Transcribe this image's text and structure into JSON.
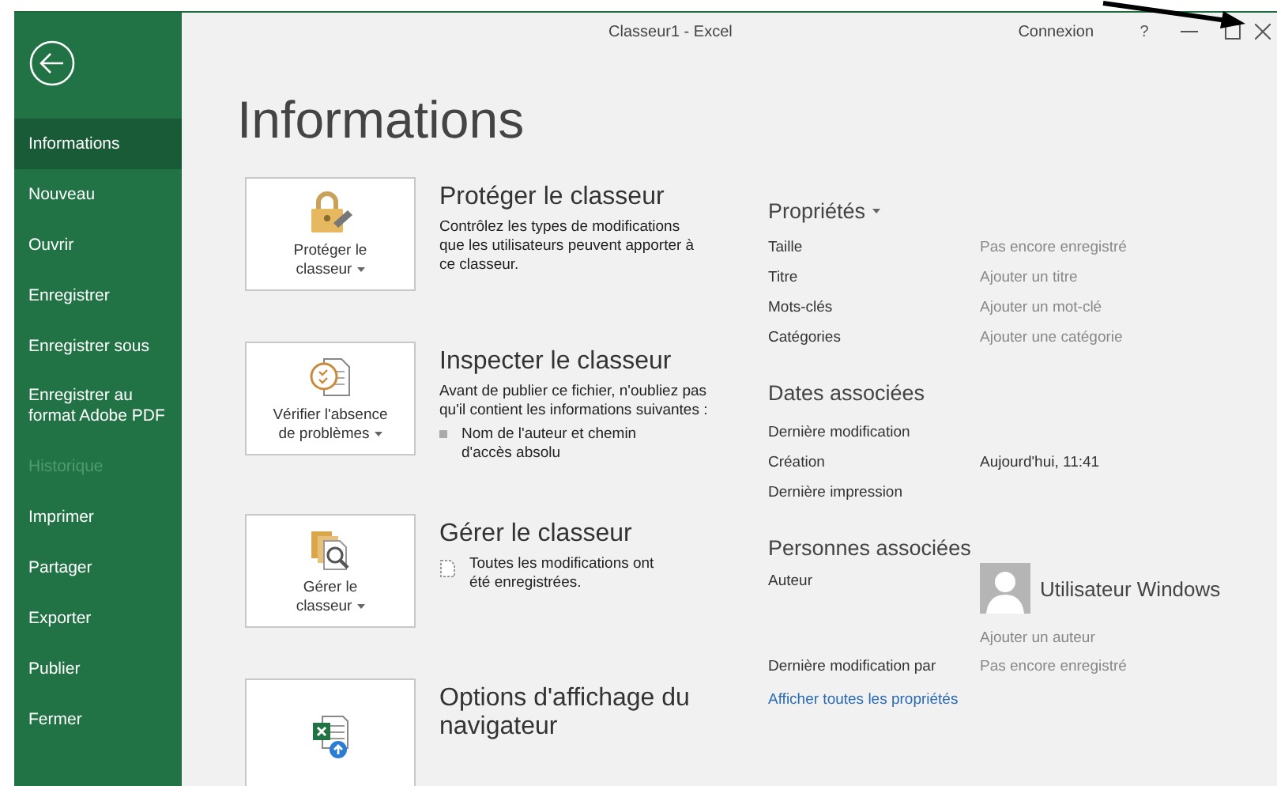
{
  "window": {
    "title": "Classeur1 - Excel",
    "account": "Connexion",
    "help": "?"
  },
  "sidebar": {
    "items": [
      {
        "label": "Informations",
        "selected": true,
        "disabled": false
      },
      {
        "label": "Nouveau",
        "selected": false,
        "disabled": false
      },
      {
        "label": "Ouvrir",
        "selected": false,
        "disabled": false
      },
      {
        "label": "Enregistrer",
        "selected": false,
        "disabled": false
      },
      {
        "label": "Enregistrer sous",
        "selected": false,
        "disabled": false
      },
      {
        "label": "Enregistrer au format Adobe PDF",
        "selected": false,
        "disabled": false
      },
      {
        "label": "Historique",
        "selected": false,
        "disabled": true
      },
      {
        "label": "Imprimer",
        "selected": false,
        "disabled": false
      },
      {
        "label": "Partager",
        "selected": false,
        "disabled": false
      },
      {
        "label": "Exporter",
        "selected": false,
        "disabled": false
      },
      {
        "label": "Publier",
        "selected": false,
        "disabled": false
      },
      {
        "label": "Fermer",
        "selected": false,
        "disabled": false
      }
    ]
  },
  "page": {
    "title": "Informations"
  },
  "actions": [
    {
      "kind": "protect",
      "button_label": "Protéger le\nclasseur",
      "title": "Protéger le classeur",
      "description": "Contrôlez les types de modifications que les utilisateurs peuvent apporter à ce classeur."
    },
    {
      "kind": "inspect",
      "button_label": "Vérifier l'absence\nde problèmes",
      "title": "Inspecter le classeur",
      "description": "Avant de publier ce fichier, n'oubliez pas qu'il contient les informations suivantes :",
      "bullets": [
        "Nom de l'auteur et chemin d'accès absolu"
      ]
    },
    {
      "kind": "manage",
      "button_label": "Gérer le\nclasseur",
      "title": "Gérer le classeur",
      "note": "Toutes les modifications ont été enregistrées."
    },
    {
      "kind": "browser",
      "title": "Options d'affichage du navigateur"
    }
  ],
  "properties": {
    "title": "Propriétés",
    "rows": [
      {
        "label": "Taille",
        "value": "Pas encore enregistré",
        "muted": true
      },
      {
        "label": "Titre",
        "value": "Ajouter un titre",
        "muted": true
      },
      {
        "label": "Mots-clés",
        "value": "Ajouter un mot-clé",
        "muted": true
      },
      {
        "label": "Catégories",
        "value": "Ajouter une catégorie",
        "muted": true
      }
    ]
  },
  "dates": {
    "title": "Dates associées",
    "rows": [
      {
        "label": "Dernière modification"
      },
      {
        "label": "Création",
        "value": "Aujourd'hui, 11:41",
        "muted": false
      },
      {
        "label": "Dernière impression"
      }
    ]
  },
  "people": {
    "title": "Personnes associées",
    "author_label": "Auteur",
    "author_name": "Utilisateur Windows",
    "add_author": "Ajouter un auteur",
    "rows": [
      {
        "label": "Dernière modification par",
        "value": "Pas encore enregistré",
        "muted": true
      }
    ]
  },
  "show_all_link": "Afficher toutes les propriétés"
}
